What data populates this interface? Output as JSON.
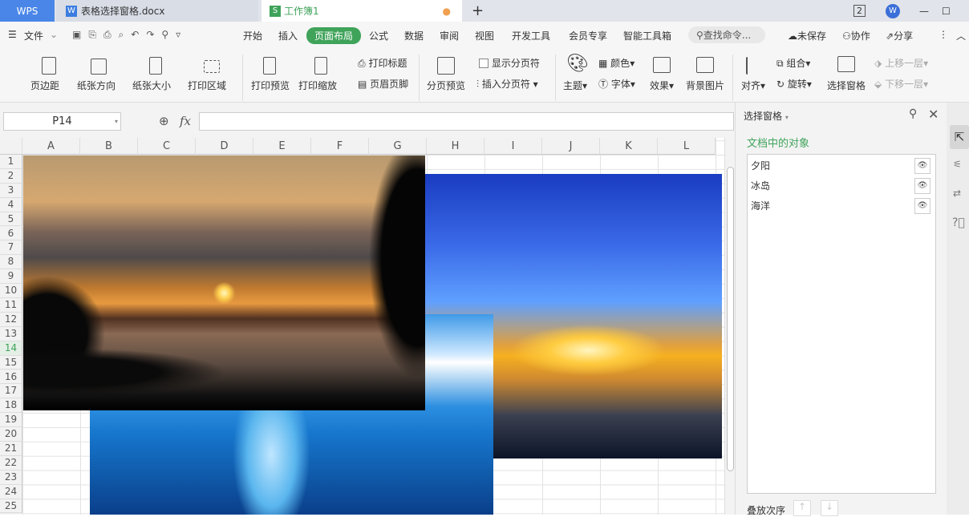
{
  "tabs": {
    "wps": "WPS",
    "doc": "表格选择窗格.docx",
    "sheet": "工作簿1",
    "new": "+",
    "count": "2"
  },
  "menu": {
    "file": "文件",
    "items": [
      "开始",
      "插入",
      "页面布局",
      "公式",
      "数据",
      "审阅",
      "视图",
      "开发工具",
      "会员专享",
      "智能工具箱"
    ],
    "active": "页面布局",
    "search": "查找命令...",
    "unsaved": "未保存",
    "collab": "协作",
    "share": "分享"
  },
  "ribbon": {
    "margins": "页边距",
    "orientation": "纸张方向",
    "size": "纸张大小",
    "print_area": "打印区域",
    "print_preview": "打印预览",
    "print_scale": "打印缩放",
    "print_titles": "打印标题",
    "header_footer": "页眉页脚",
    "page_break_preview": "分页预览",
    "show_breaks": "显示分页符",
    "insert_break": "插入分页符",
    "theme": "主题",
    "colors": "颜色",
    "fonts": "字体",
    "effects": "效果",
    "background": "背景图片",
    "align": "对齐",
    "group": "组合",
    "rotate": "旋转",
    "selection_pane": "选择窗格",
    "bring_forward": "上移一层",
    "send_backward": "下移一层"
  },
  "formula": {
    "cell_ref": "P14",
    "fx": "fx",
    "value": ""
  },
  "sheet": {
    "columns": [
      "A",
      "B",
      "C",
      "D",
      "E",
      "F",
      "G",
      "H",
      "I",
      "J",
      "K",
      "L"
    ],
    "rows": [
      "1",
      "2",
      "3",
      "4",
      "5",
      "6",
      "7",
      "8",
      "9",
      "10",
      "11",
      "12",
      "13",
      "14",
      "15",
      "16",
      "17",
      "18",
      "19",
      "20",
      "21",
      "22",
      "23",
      "24",
      "25"
    ],
    "active_row": "14"
  },
  "panel": {
    "title": "选择窗格",
    "section": "文档中的对象",
    "objects": [
      "夕阳",
      "冰岛",
      "海洋"
    ],
    "order_label": "叠放次序"
  },
  "colors": {
    "accent": "#3fa35a",
    "wps_blue": "#4a86e8"
  }
}
